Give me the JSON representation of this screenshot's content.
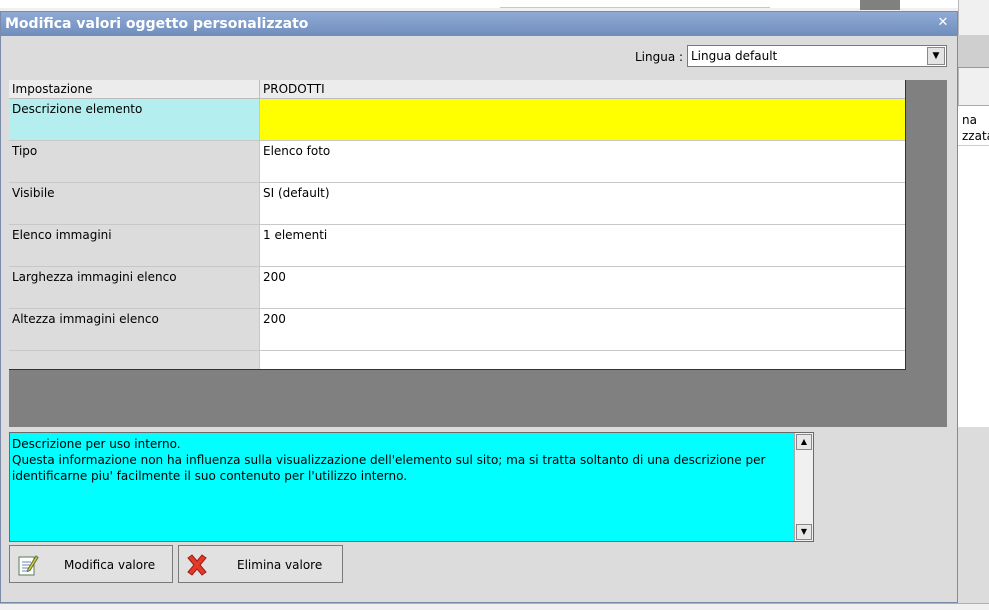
{
  "window": {
    "title": "Modifica valori oggetto personalizzato"
  },
  "language": {
    "label": "Lingua :",
    "selected": "Lingua default"
  },
  "grid": {
    "headers": [
      "Impostazione",
      "PRODOTTI"
    ],
    "rows": [
      {
        "key": "Descrizione elemento",
        "value": ""
      },
      {
        "key": "Tipo",
        "value": "Elenco foto"
      },
      {
        "key": "Visibile",
        "value": "SI (default)"
      },
      {
        "key": "Elenco immagini",
        "value": "1 elementi"
      },
      {
        "key": "Larghezza immagini elenco",
        "value": "200"
      },
      {
        "key": "Altezza immagini elenco",
        "value": "200"
      }
    ]
  },
  "description": {
    "lines": [
      "Descrizione per uso interno.",
      "Questa informazione non ha influenza sulla visualizzazione dell'elemento sul sito; ma si tratta soltanto di una descrizione per",
      "identificarne piu' facilmente il suo contenuto per l'utilizzo interno."
    ]
  },
  "buttons": {
    "edit": "Modifica valore",
    "delete": "Elimina valore"
  },
  "background": {
    "right_text": [
      "na",
      "zzata"
    ]
  },
  "icons": {
    "close": "close-icon",
    "edit": "edit-note-icon",
    "delete": "red-x-icon"
  },
  "colors": {
    "selected_key": "#b4eeee",
    "selected_value": "#ffff00",
    "description_bg": "#00ffff"
  }
}
